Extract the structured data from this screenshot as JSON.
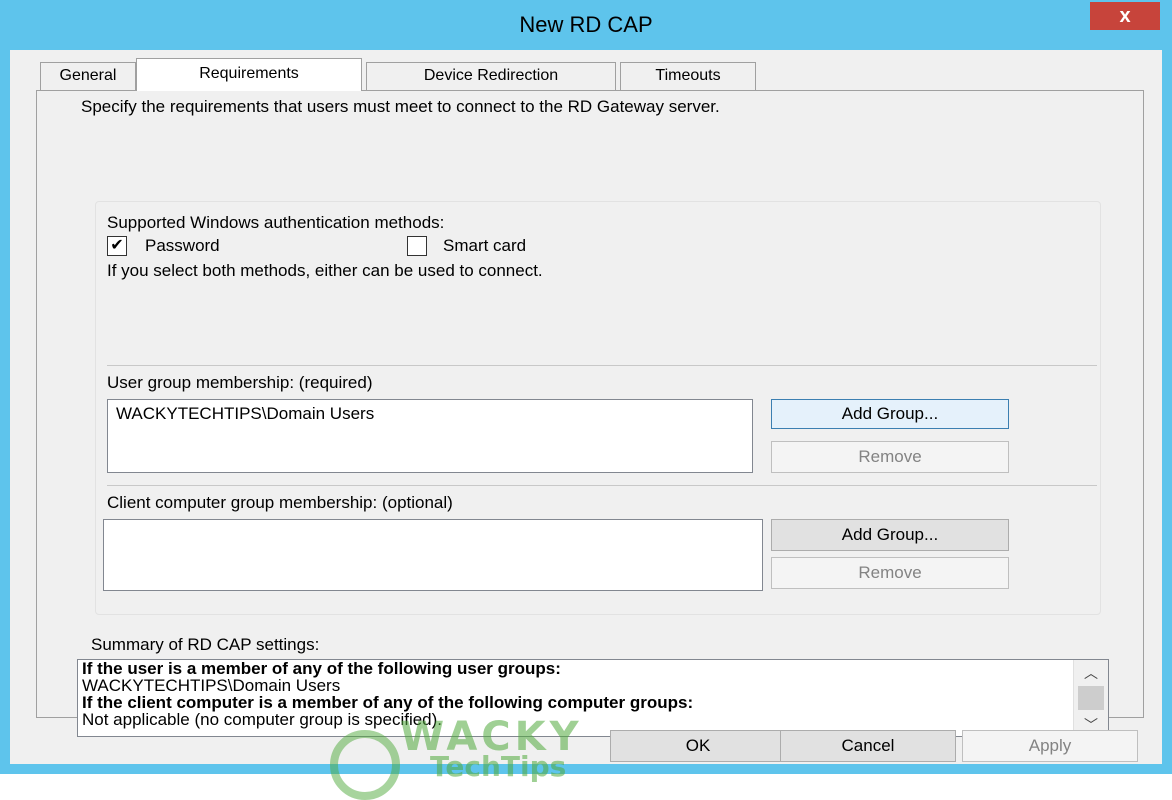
{
  "window": {
    "title": "New RD CAP",
    "close_label": "x"
  },
  "tabs": [
    {
      "label": "General"
    },
    {
      "label": "Requirements"
    },
    {
      "label": "Device Redirection"
    },
    {
      "label": "Timeouts"
    }
  ],
  "requirements": {
    "intro": "Specify the requirements that users must meet to connect to the RD Gateway server.",
    "auth_methods_label": "Supported Windows authentication methods:",
    "password_label": "Password",
    "password_checked": true,
    "smartcard_label": "Smart card",
    "smartcard_checked": false,
    "both_note": "If you select both methods, either can be used to connect.",
    "user_group_label": "User group membership: (required)",
    "user_groups": [
      "WACKYTECHTIPS\\Domain Users"
    ],
    "add_group_label": "Add Group...",
    "remove_label": "Remove",
    "client_group_label": "Client computer group membership: (optional)",
    "client_add_group_label": "Add Group...",
    "client_remove_label": "Remove",
    "summary_label": "Summary of RD CAP settings:",
    "summary": {
      "line1": "If the user is a member of any of the following user groups:",
      "line2": "WACKYTECHTIPS\\Domain Users",
      "line3": "If the client computer is a member of any of the following computer groups:",
      "line4": "Not applicable (no computer group is specified)."
    }
  },
  "footer": {
    "ok_label": "OK",
    "cancel_label": "Cancel",
    "apply_label": "Apply"
  },
  "watermark": {
    "text": "WACKY",
    "sub": "TechTips"
  }
}
